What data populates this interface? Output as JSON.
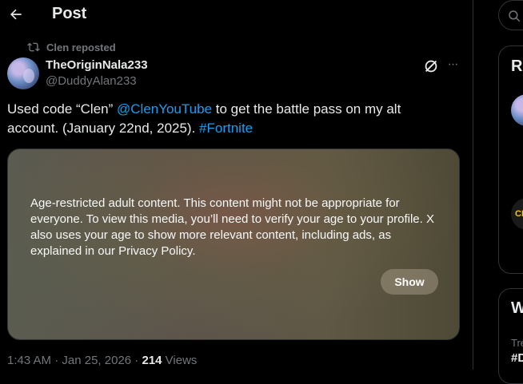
{
  "header": {
    "title": "Post"
  },
  "repost": {
    "label": "Clen reposted"
  },
  "author": {
    "name": "TheOriginNala233",
    "handle": "@DuddyAlan233"
  },
  "tweet": {
    "text_before": "Used code “Clen” ",
    "mention": "@ClenYouTube",
    "text_middle": " to get the battle pass on my alt account. (January 22nd, 2025). ",
    "hashtag": "#Fortnite"
  },
  "media": {
    "warning": "Age-restricted adult content. This content might not be appropriate for everyone. To view this media, you’ll need to verify your age to your profile. X also uses your age to show more relevant content, including ads, as explained in our Privacy Policy.",
    "show_label": "Show"
  },
  "meta": {
    "time": "1:43 AM",
    "sep1": " · ",
    "date": "Jan 25, 2026",
    "sep2": " · ",
    "views_count": "214",
    "views_label": " Views"
  },
  "sidebar": {
    "panel1_heading": "R",
    "panel2_heading": "W",
    "panel2_sub": "Tre",
    "panel2_tag": "#D",
    "avatar3_text": "CL"
  },
  "colors": {
    "accent": "#1d9bf0",
    "muted": "#71767b",
    "text": "#e7e9ea",
    "border": "#2f3336"
  },
  "icons": [
    "back-arrow-icon",
    "repost-icon",
    "grok-icon",
    "more-icon",
    "search-icon"
  ]
}
